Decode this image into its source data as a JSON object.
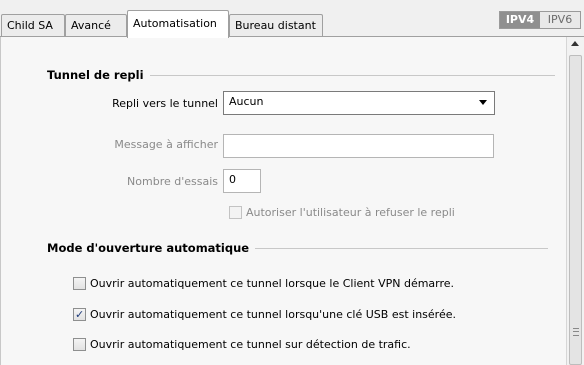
{
  "tabs": [
    {
      "label": "Child SA",
      "active": false
    },
    {
      "label": "Avancé",
      "active": false
    },
    {
      "label": "Automatisation",
      "active": true
    },
    {
      "label": "Bureau distant",
      "active": false
    }
  ],
  "ip_toggle": {
    "ipv4": "IPV4",
    "ipv6": "IPV6",
    "selected": "IPV4"
  },
  "fallback": {
    "section_title": "Tunnel de repli",
    "tunnel_label": "Repli vers le tunnel",
    "tunnel_value": "Aucun",
    "message_label": "Message à afficher",
    "message_value": "",
    "attempts_label": "Nombre d'essais",
    "attempts_value": "0",
    "allow_refuse_label": "Autoriser l'utilisateur à refuser le repli",
    "allow_refuse_checked": false
  },
  "auto_open": {
    "section_title": "Mode d'ouverture automatique",
    "options": [
      {
        "label": "Ouvrir automatiquement ce tunnel lorsque le Client VPN démarre.",
        "checked": false
      },
      {
        "label": "Ouvrir automatiquement ce tunnel lorsqu'une clé USB est insérée.",
        "checked": true
      },
      {
        "label": "Ouvrir automatiquement ce tunnel sur détection de trafic.",
        "checked": false
      }
    ]
  },
  "colors": {
    "ipv4_bg": "#8f8f8f",
    "check_color": "#1f3b7a"
  }
}
